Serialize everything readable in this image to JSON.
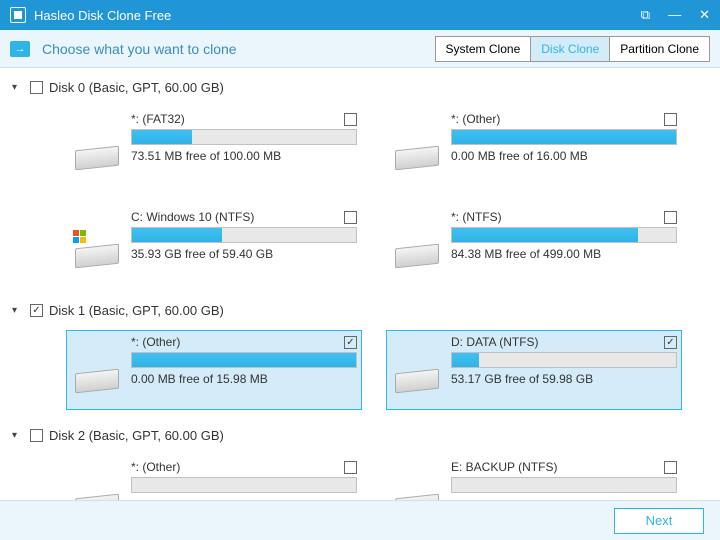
{
  "titlebar": {
    "title": "Hasleo Disk Clone Free"
  },
  "subhead": {
    "text": "Choose what you want to clone",
    "tabs": [
      "System Clone",
      "Disk Clone",
      "Partition Clone"
    ],
    "active_tab": 1
  },
  "disks": [
    {
      "checked": false,
      "label": "Disk 0 (Basic, GPT, 60.00 GB)",
      "rows": [
        [
          {
            "name": "*: (FAT32)",
            "checked": false,
            "fill_pct": 27,
            "free": "73.51 MB free of 100.00 MB",
            "os": false
          },
          {
            "name": "*: (Other)",
            "checked": false,
            "fill_pct": 100,
            "free": "0.00 MB free of 16.00 MB",
            "os": false
          }
        ],
        [
          {
            "name": "C: Windows 10 (NTFS)",
            "checked": false,
            "fill_pct": 40,
            "free": "35.93 GB free of 59.40 GB",
            "os": true
          },
          {
            "name": "*: (NTFS)",
            "checked": false,
            "fill_pct": 83,
            "free": "84.38 MB free of 499.00 MB",
            "os": false
          }
        ]
      ]
    },
    {
      "checked": true,
      "label": "Disk 1 (Basic, GPT, 60.00 GB)",
      "rows": [
        [
          {
            "name": "*: (Other)",
            "checked": true,
            "fill_pct": 100,
            "free": "0.00 MB free of 15.98 MB",
            "os": false,
            "selected": true
          },
          {
            "name": "D: DATA (NTFS)",
            "checked": true,
            "fill_pct": 12,
            "free": "53.17 GB free of 59.98 GB",
            "os": false,
            "selected": true
          }
        ]
      ]
    },
    {
      "checked": false,
      "label": "Disk 2 (Basic, GPT, 60.00 GB)",
      "rows": [
        [
          {
            "name": "*: (Other)",
            "checked": false,
            "fill_pct": 0,
            "free": "",
            "os": false
          },
          {
            "name": "E: BACKUP (NTFS)",
            "checked": false,
            "fill_pct": 0,
            "free": "",
            "os": false
          }
        ]
      ]
    }
  ],
  "footer": {
    "next": "Next"
  }
}
